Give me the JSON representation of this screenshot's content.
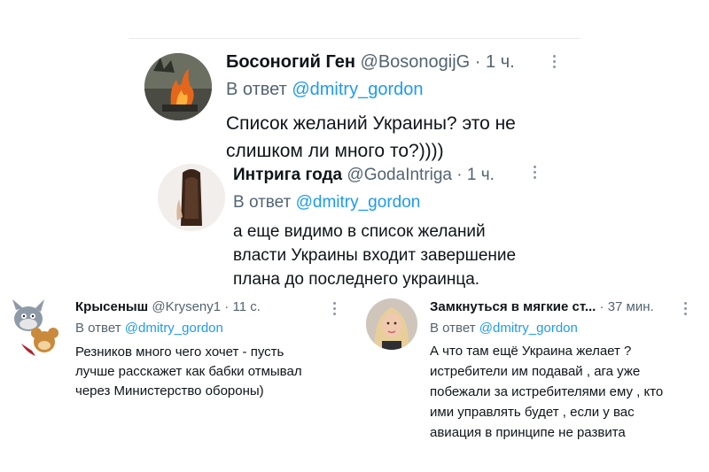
{
  "tweets": [
    {
      "name": "Босоногий Ген",
      "handle": "@BosonogijG",
      "dot": "·",
      "time": "1 ч.",
      "reply_prefix": "В ответ",
      "mention": "@dmitry_gordon",
      "text_lines": [
        "Список желаний Украины? это не",
        "слишком ли много то?))))"
      ]
    },
    {
      "name": "Интрига года",
      "handle": "@GodaIntriga",
      "dot": "·",
      "time": "1 ч.",
      "reply_prefix": "В ответ",
      "mention": "@dmitry_gordon",
      "text_lines": [
        "а еще видимо в список желаний",
        "власти Украины входит завершение",
        "плана до последнего украинца."
      ]
    },
    {
      "name": "Крысеныш",
      "handle": "@Kryseny1",
      "dot": "·",
      "time": "11 с.",
      "reply_prefix": "В ответ",
      "mention": "@dmitry_gordon",
      "text_lines": [
        "Резников много чего хочет - пусть",
        "лучше расскажет как бабки отмывал",
        "через Министерство обороны)"
      ]
    },
    {
      "name": "Замкнуться в мягкие ст...",
      "handle": "",
      "dot": "·",
      "time": "37 мин.",
      "reply_prefix": "В ответ",
      "mention": "@dmitry_gordon",
      "text_lines": [
        "А что там ещё Украина желает ?",
        "истребители им подавай , ага уже",
        "побежали за истребителями ему , кто",
        "ими управлять будет , если у вас",
        "авиация в принципе не развита"
      ]
    }
  ],
  "icons": {
    "more": "more-options-icon",
    "avatar_1": "fire-avatar",
    "avatar_2": "long-hair-avatar",
    "avatar_3": "tom-and-jerry-avatar",
    "avatar_4": "blonde-woman-avatar"
  },
  "colors": {
    "text": "#0f1419",
    "muted": "#536471",
    "link": "#1d9bf0",
    "divider": "#e7e9ea"
  }
}
